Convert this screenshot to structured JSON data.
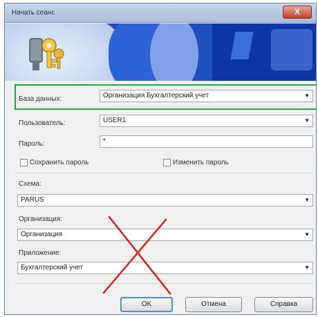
{
  "window": {
    "title": "Начать сеанс",
    "close_glyph": "X"
  },
  "banner": {
    "icon": "keys-icon"
  },
  "form": {
    "database": {
      "label": "База данных:",
      "value": "Организация Бухгалтерский учет"
    },
    "user": {
      "label": "Пользователь:",
      "value": "USER1"
    },
    "password": {
      "label": "Пароль:",
      "value": "*"
    },
    "save_password": {
      "label": "Сохранить пароль",
      "checked": false
    },
    "change_password": {
      "label": "Изменить пароль",
      "checked": false
    },
    "scheme": {
      "label": "Схема:",
      "value": "PARUS"
    },
    "organization": {
      "label": "Организация:",
      "value": "Организация"
    },
    "application": {
      "label": "Приложение:",
      "value": "Бухгалтерский учет"
    }
  },
  "buttons": {
    "ok": "OK",
    "cancel": "Отмена",
    "help": "Справка"
  },
  "colors": {
    "highlight_frame": "#27a24a",
    "cross_mark": "#d9231f"
  }
}
